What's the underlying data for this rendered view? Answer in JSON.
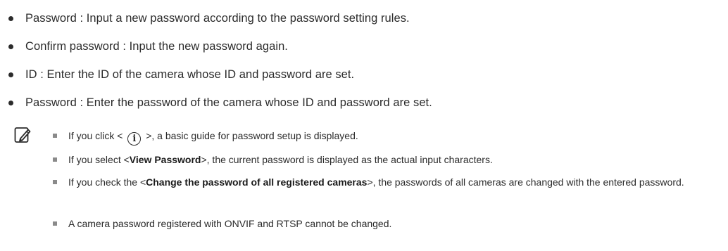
{
  "bullets": [
    "Password : Input a new password according to the password setting rules.",
    "Confirm password : Input the new password again.",
    "ID : Enter the ID of the camera whose ID and password are set.",
    "Password : Enter the password of the camera whose ID and password are set."
  ],
  "notes": {
    "icon": "note-pencil-icon",
    "items": [
      {
        "pre": "If you click < ",
        "icon_glyph": "i",
        "post": " >, a basic guide for password setup is displayed."
      },
      {
        "pre": "If you select <",
        "bold": "View Password",
        "post": ">, the current password is displayed as the actual input characters."
      },
      {
        "pre": "If you check the <",
        "bold": "Change the password of all registered cameras",
        "post": ">, the passwords of all cameras are changed with the entered password."
      },
      {
        "text": "A camera password registered with ONVIF and RTSP cannot be changed."
      }
    ]
  }
}
